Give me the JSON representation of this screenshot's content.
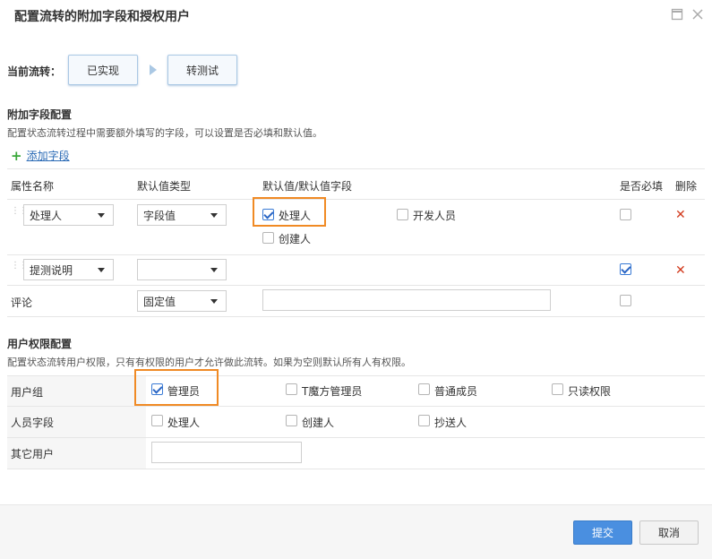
{
  "dialog": {
    "title": "配置流转的附加字段和授权用户",
    "current_flow_label": "当前流转：",
    "flow_from": "已实现",
    "flow_to": "转测试"
  },
  "fields_section": {
    "title": "附加字段配置",
    "description": "配置状态流转过程中需要额外填写的字段，可以设置是否必填和默认值。",
    "add_field": "添加字段",
    "headers": {
      "name": "属性名称",
      "default_type": "默认值类型",
      "default_value": "默认值/默认值字段",
      "required": "是否必填",
      "delete": "删除"
    },
    "rows": [
      {
        "name": "处理人",
        "default_type": "字段值",
        "options": [
          {
            "label": "处理人",
            "checked": true
          },
          {
            "label": "开发人员",
            "checked": false
          },
          {
            "label": "创建人",
            "checked": false
          }
        ],
        "required": false,
        "delete_icon": "✕"
      },
      {
        "name": "提测说明",
        "default_type": "",
        "required": true,
        "delete_icon": "✕"
      },
      {
        "name": "评论",
        "default_type": "固定值",
        "default_value": "",
        "required": false
      }
    ]
  },
  "permissions_section": {
    "title": "用户权限配置",
    "description": "配置状态流转用户权限，只有有权限的用户才允许做此流转。如果为空则默认所有人有权限。",
    "user_group": {
      "label": "用户组",
      "options": [
        {
          "label": "管理员",
          "checked": true
        },
        {
          "label": "T魔方管理员",
          "checked": false
        },
        {
          "label": "普通成员",
          "checked": false
        },
        {
          "label": "只读权限",
          "checked": false
        }
      ]
    },
    "person_field": {
      "label": "人员字段",
      "options": [
        {
          "label": "处理人",
          "checked": false
        },
        {
          "label": "创建人",
          "checked": false
        },
        {
          "label": "抄送人",
          "checked": false
        }
      ]
    },
    "other_users": {
      "label": "其它用户",
      "value": ""
    }
  },
  "footer": {
    "submit": "提交",
    "cancel": "取消"
  },
  "colors": {
    "primary": "#4a8fe0",
    "highlight": "#f08a24",
    "delete": "#d23b1e",
    "add": "#3aa83a"
  }
}
